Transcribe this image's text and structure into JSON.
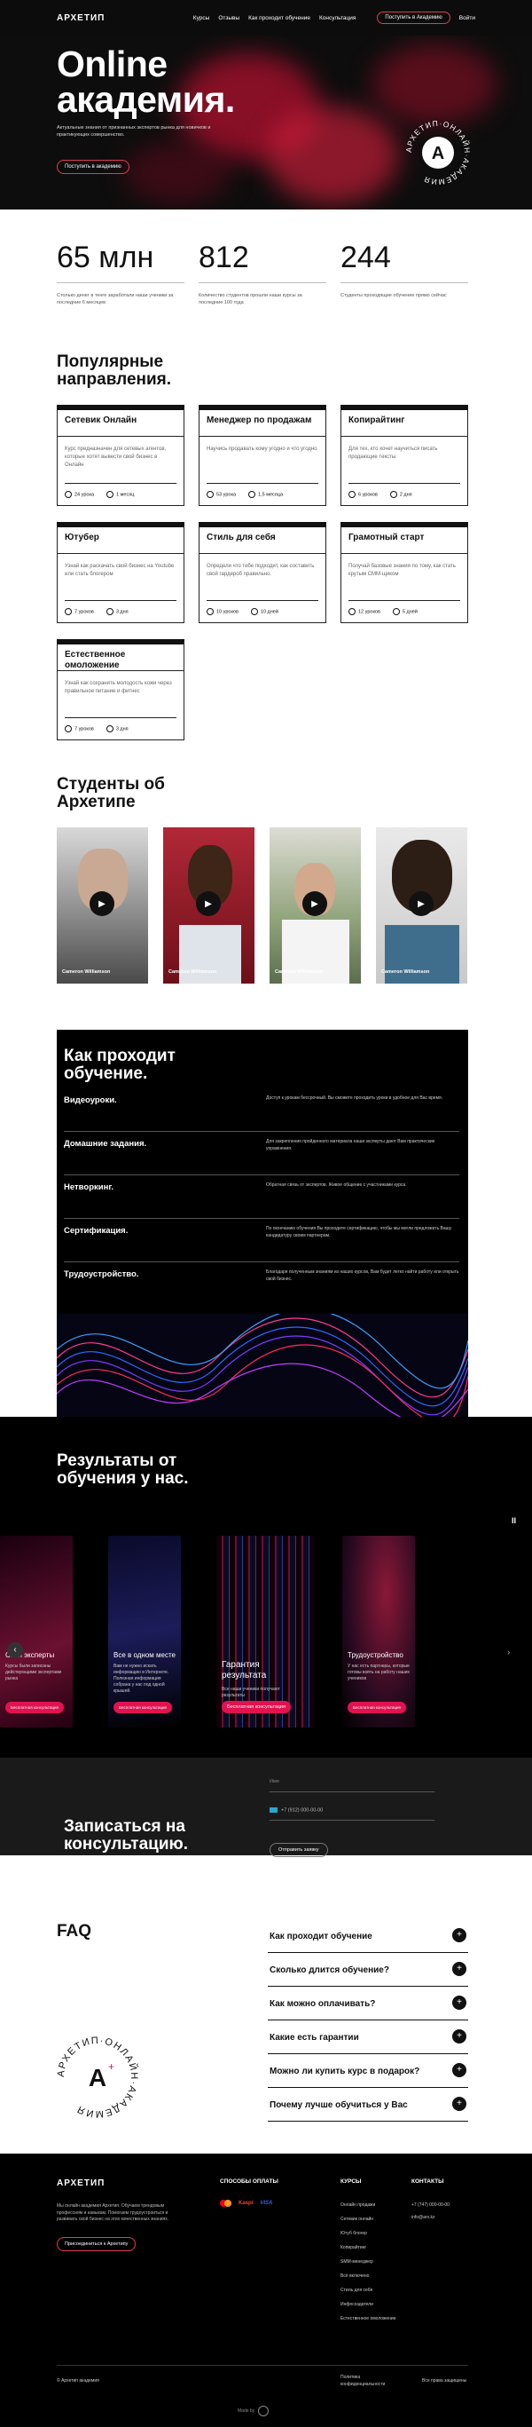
{
  "header": {
    "logo": "АРХЕТИП",
    "nav": [
      "Курсы",
      "Отзывы",
      "Как проходит обучение",
      "Консультация"
    ],
    "cta": "Поступить в Академию",
    "login": "Войти"
  },
  "hero": {
    "title_line1": "Online",
    "title_line2": "академия.",
    "subtitle": "Актуальные знания от признанных экспертов рынка для новичков и практикующих совершенство.",
    "button": "Поступить в академию",
    "badge_text": "АРХЕТИП·ОНЛАЙН·АКАДЕМИЯ",
    "badge_letter": "А"
  },
  "stats": [
    {
      "value": "65 млн",
      "desc": "Столько денег в тенге заработали наши ученики за последние 6 месяцев"
    },
    {
      "value": "812",
      "desc": "Количество студентов прошли наши курсы за последние 100 года"
    },
    {
      "value": "244",
      "desc": "Студенты проходящие обучение прямо сейчас"
    }
  ],
  "courses": {
    "heading": "Популярные направления.",
    "items": [
      {
        "title": "Сетевик Онлайн",
        "desc": "Курс предназначен для сетевых агентов, которые хотят вывести свой бизнес в Онлайн",
        "lessons": "24 урока",
        "duration": "1 месяц"
      },
      {
        "title": "Менеджер по продажам",
        "desc": "Научись продавать кому угодно и что угодно",
        "lessons": "53 урока",
        "duration": "1,5 месяца"
      },
      {
        "title": "Копирайтинг",
        "desc": "Для тех, кто хочет научиться писать продающие тексты",
        "lessons": "6 уроков",
        "duration": "2 дня"
      },
      {
        "title": "Ютубер",
        "desc": "Узнай как раскачать свой бизнес на Youtube или стать блогером",
        "lessons": "7 уроков",
        "duration": "3 дня"
      },
      {
        "title": "Стиль для себя",
        "desc": "Определи что тебе подходит, как составить свой гардероб правильно.",
        "lessons": "10 уроков",
        "duration": "10 дней"
      },
      {
        "title": "Грамотный старт",
        "desc": "Получай базовые знания по тому, как стать крутым СММ-щиком",
        "lessons": "12 уроков",
        "duration": "5 дней"
      },
      {
        "title": "Естественное омоложение",
        "desc": "Узнай как сохранить молодость кожи через правильное питание и фитнес",
        "lessons": "7 уроков",
        "duration": "3 дня"
      }
    ]
  },
  "students": {
    "heading": "Студенты об Архетипе",
    "items": [
      {
        "name": "Cameron Williamson"
      },
      {
        "name": "Cameron Williamson"
      },
      {
        "name": "Cameron Williamson"
      },
      {
        "name": "Cameron Williamson"
      }
    ]
  },
  "how": {
    "heading": "Как проходит обучение.",
    "rows": [
      {
        "key": "Видеоуроки.",
        "value": "Доступ к урокам бессрочный. Вы сможете проходить уроки в удобное для Вас время."
      },
      {
        "key": "Домашние задания.",
        "value": "Для закрепления пройденного материала наши эксперты дают Вам практические упражнения."
      },
      {
        "key": "Нетворкинг.",
        "value": "Обратная связь от экспертов. Живое общение с участниками курса."
      },
      {
        "key": "Сертификация.",
        "value": "По окончанию обучения Вы проходите сертификацию, чтобы мы могли предложить Вашу кандидатуру своим партнерам."
      },
      {
        "key": "Трудоустройство.",
        "value": "Благодаря полученным знаниям из наших курсов, Вам будет легко найти работу или открыть свой бизнес."
      }
    ]
  },
  "results": {
    "heading": "Результаты от обучения у нас.",
    "pause": "II",
    "slides": [
      {
        "title": "Свои эксперты",
        "desc": "Курсы были записаны действующими экспертами рынка",
        "button": "Бесплатная консультация"
      },
      {
        "title": "Все в одном месте",
        "desc": "Вам не нужно искать информацию в Интернете. Полезная информация собрана у нас под одной крышей.",
        "button": "Бесплатная консультация"
      },
      {
        "title": "Гарантия результата",
        "desc": "Все наши ученики получают результаты",
        "button": "Бесплатная консультация"
      },
      {
        "title": "Трудоустройство",
        "desc": "У нас есть партнеры, которые готовы взять на работу наших учеников",
        "button": "Бесплатная консультация"
      }
    ]
  },
  "consult": {
    "heading": "Записаться на консультацию.",
    "name_placeholder": "Имя",
    "phone_value": "+7 (912) 000-00-00",
    "button": "Отправить заявку"
  },
  "faq": {
    "heading": "FAQ",
    "items": [
      "Как проходит обучение",
      "Сколько длится обучение?",
      "Как можно оплачивать?",
      "Какие есть гарантии",
      "Можно ли купить курс в подарок?",
      "Почему лучше обучиться у Вас"
    ],
    "seal_letter": "А"
  },
  "footer": {
    "logo": "АРХЕТИП",
    "about": "Мы онлайн академия Архетип. Обучаем трендовым профессиям и навыкам. Помогаем трудоустроиться и развивать свой бизнес на этих качественных знаниях.",
    "join_button": "Присоединиться к Архетипу",
    "pay_heading": "СПОСОБЫ ОПЛАТЫ",
    "pay_methods": [
      "MC",
      "Kaspi",
      "VISA"
    ],
    "courses_heading": "КУРСЫ",
    "courses": [
      "Онлайн продажи",
      "Сетевик онлайн",
      "Ютуб блогер",
      "Копирайтинг",
      "SMM-менеджер",
      "Всё включено",
      "Стиль для себя",
      "Инфосоздатели",
      "Естественное омоложение"
    ],
    "contacts_heading": "КОНТАКТЫ",
    "phone": "+7 (747) 000-00-00",
    "email": "info@arx.kz",
    "copyright": "© Архетип академия",
    "privacy": "Политика конфиденциальности",
    "rights": "Все права защищены",
    "made_by": "Made by"
  }
}
